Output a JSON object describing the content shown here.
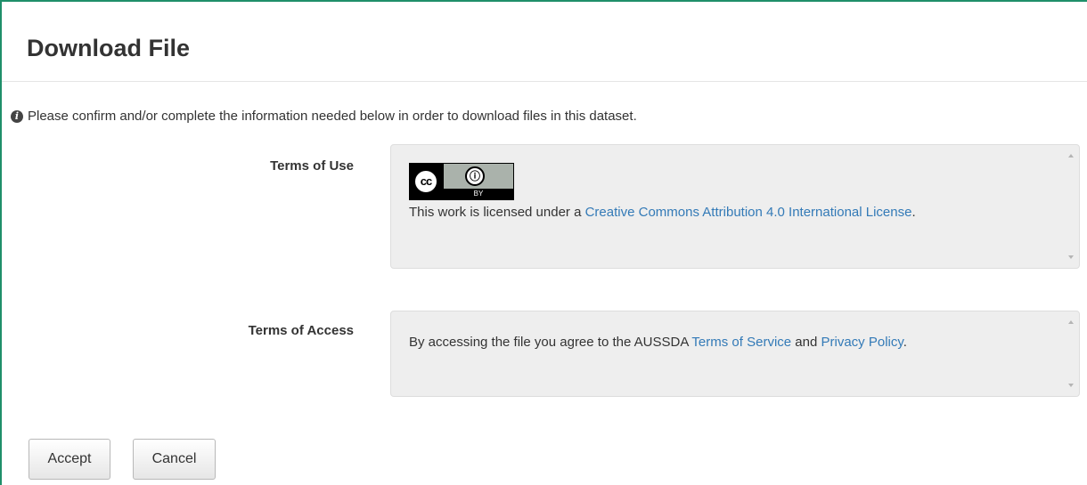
{
  "dialog": {
    "title": "Download File",
    "info_text": "Please confirm and/or complete the information needed below in order to download files in this dataset."
  },
  "terms_of_use": {
    "label": "Terms of Use",
    "badge": {
      "cc_text": "cc",
      "by_text": "BY",
      "person_glyph": "ⓘ"
    },
    "text_before": "This work is licensed under a ",
    "link_text": "Creative Commons Attribution 4.0 International License",
    "text_after": "."
  },
  "terms_of_access": {
    "label": "Terms of Access",
    "text_before": "By accessing the file you agree to the AUSSDA ",
    "link1": "Terms of Service",
    "text_middle": " and ",
    "link2": "Privacy Policy",
    "text_after": "."
  },
  "buttons": {
    "accept": "Accept",
    "cancel": "Cancel"
  },
  "colors": {
    "accent_border": "#1f8f6a",
    "link": "#337ab7",
    "box_bg": "#eeeeee"
  },
  "icons": {
    "info": "info-circle-icon",
    "scroll_up": "scroll-up-arrow-icon",
    "scroll_down": "scroll-down-arrow-icon"
  }
}
